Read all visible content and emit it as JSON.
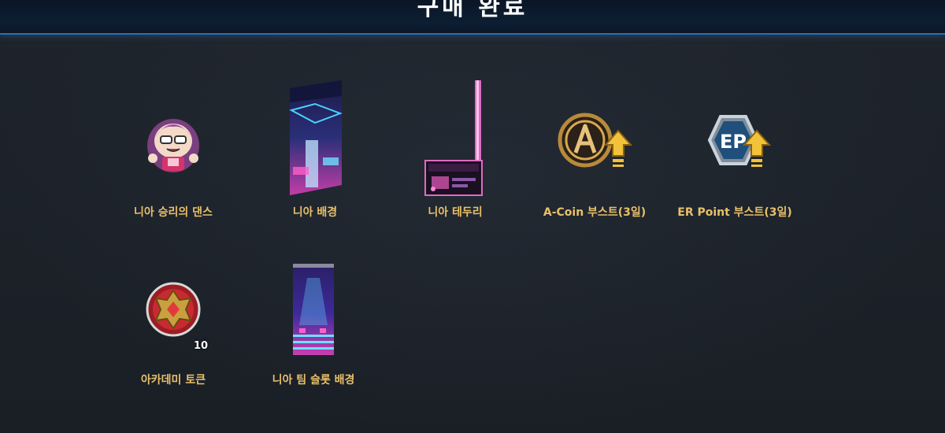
{
  "header": {
    "title": "구매 완료"
  },
  "items": [
    {
      "label": "니아 승리의 댄스",
      "icon": "character-dance-icon"
    },
    {
      "label": "니아 배경",
      "icon": "background-card-icon"
    },
    {
      "label": "니아 테두리",
      "icon": "frame-border-icon"
    },
    {
      "label": "A-Coin 부스트(3일)",
      "icon": "a-coin-boost-icon"
    },
    {
      "label": "ER Point 부스트(3일)",
      "icon": "ep-boost-icon",
      "badge_text": "EP"
    },
    {
      "label": "아카데미 토큰",
      "icon": "academy-token-icon",
      "quantity": "10"
    },
    {
      "label": "니아 팀 슬롯 배경",
      "icon": "team-slot-background-icon"
    }
  ],
  "colors": {
    "label": "#e8c06a",
    "header_border": "#2c6fa8",
    "background": "#1b2027"
  }
}
